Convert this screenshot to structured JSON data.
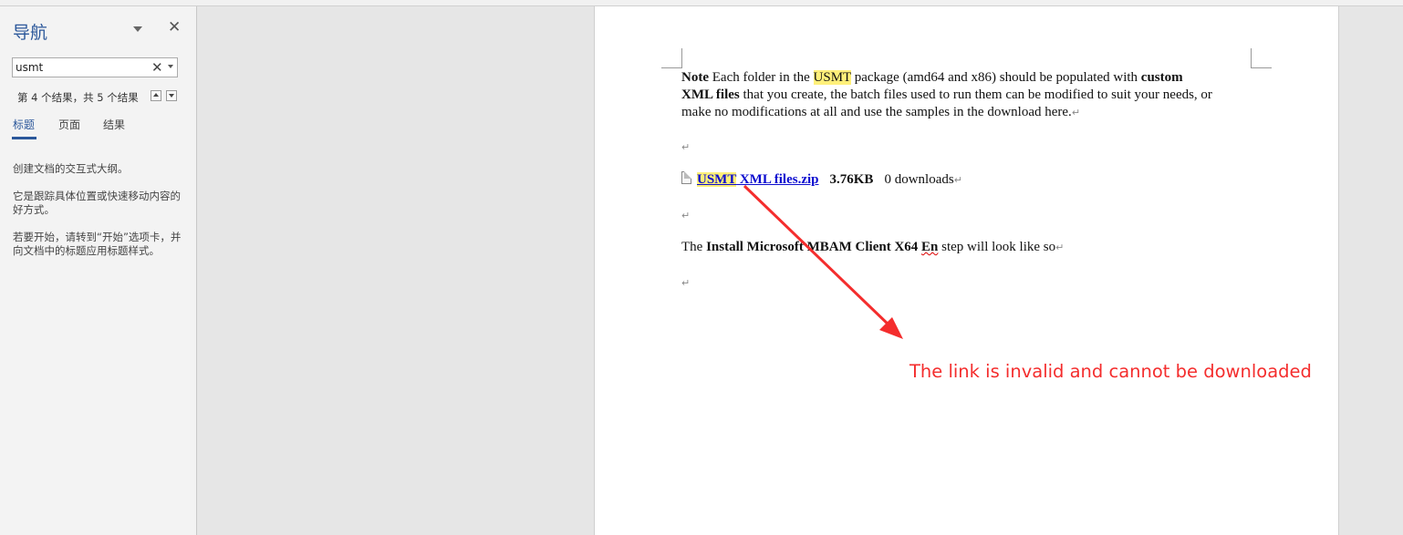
{
  "navigation_pane": {
    "title": "导航",
    "search": {
      "value": "usmt"
    },
    "result_count": "第 4 个结果，共 5 个结果",
    "tabs": [
      {
        "label": "标题",
        "active": true
      },
      {
        "label": "页面",
        "active": false
      },
      {
        "label": "结果",
        "active": false
      }
    ],
    "hints": [
      "创建文档的交互式大纲。",
      "它是跟踪具体位置或快速移动内容的好方式。",
      "若要开始，请转到“开始”选项卡，并向文档中的标题应用标题样式。"
    ]
  },
  "document": {
    "paragraph1": {
      "note_label": "Note",
      "text_a": " Each folder in the ",
      "highlight": "USMT",
      "text_b": " package (amd64 and x86) should be populated with ",
      "bold_custom": "custom",
      "bold_xml_files": "XML files",
      "text_c": " that you create, the batch files used to run them can be modified to suit your needs, or",
      "line3": "make no modifications at all and use the samples in the download here."
    },
    "download": {
      "link_highlight": "USMT",
      "link_rest": " XML files.zip",
      "size": "3.76KB",
      "downloads": "0 downloads"
    },
    "paragraph3": {
      "text_a": "The ",
      "bold_a": "Install Microsoft MBAM Client X64 ",
      "bold_squiggle": "En",
      "text_b": " step will look like so"
    },
    "para_mark": "↵"
  },
  "annotation": {
    "text": "The link is invalid and cannot be downloaded",
    "color": "#f42d2d"
  },
  "colors": {
    "accent": "#2b579a",
    "highlight": "#fff07a",
    "link": "#0b0bcf"
  }
}
